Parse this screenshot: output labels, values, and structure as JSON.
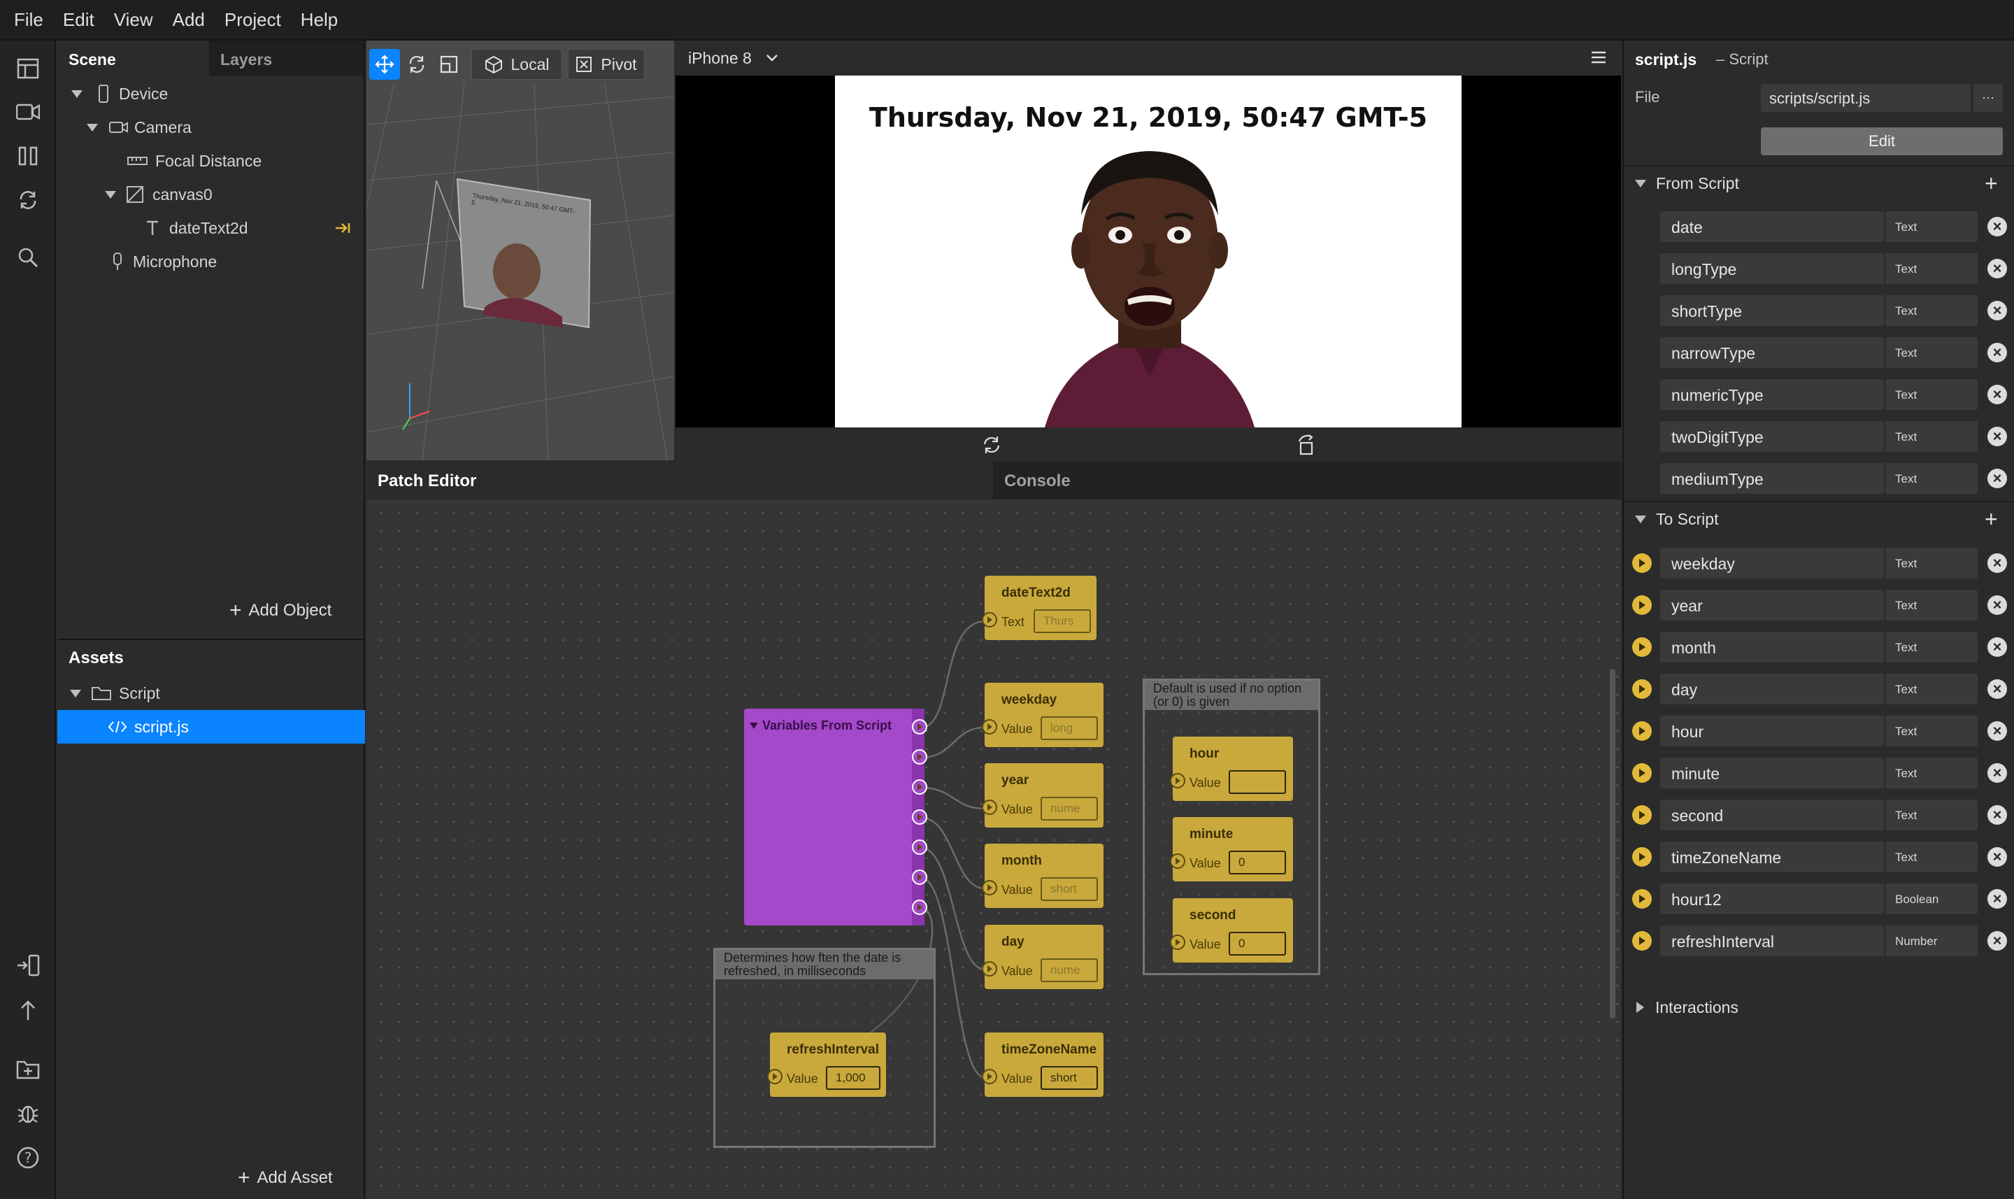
{
  "menu": [
    "File",
    "Edit",
    "View",
    "Add",
    "Project",
    "Help"
  ],
  "scene": {
    "tab_scene": "Scene",
    "tab_layers": "Layers",
    "tree": {
      "device": "Device",
      "camera": "Camera",
      "focal": "Focal Distance",
      "canvas": "canvas0",
      "text": "dateText2d",
      "mic": "Microphone"
    },
    "add_object": "Add Object"
  },
  "assets": {
    "title": "Assets",
    "folder": "Script",
    "file": "script.js",
    "add_asset": "Add Asset"
  },
  "viewport": {
    "local": "Local",
    "pivot": "Pivot",
    "preview_text": "Thursday, Nov 21, 2019, 50:47 GMT-5"
  },
  "simulator": {
    "device": "iPhone 8",
    "caption": "Thursday, Nov 21, 2019, 50:47 GMT-5"
  },
  "patch_editor": {
    "tab_patch": "Patch Editor",
    "tab_console": "Console",
    "vars_node": "Variables From Script",
    "comment_defaults": "Default is used if no option (or 0) is given",
    "comment_refresh": "Determines how ften the date is refreshed, in milliseconds",
    "nodes": {
      "datetext": {
        "title": "dateText2d",
        "label": "Text",
        "value": "Thurs"
      },
      "weekday": {
        "title": "weekday",
        "label": "Value",
        "value": "long"
      },
      "year": {
        "title": "year",
        "label": "Value",
        "value": "nume"
      },
      "month": {
        "title": "month",
        "label": "Value",
        "value": "short"
      },
      "day": {
        "title": "day",
        "label": "Value",
        "value": "nume"
      },
      "hour": {
        "title": "hour",
        "label": "Value",
        "value": ""
      },
      "minute": {
        "title": "minute",
        "label": "Value",
        "value": "0"
      },
      "second": {
        "title": "second",
        "label": "Value",
        "value": "0"
      },
      "refresh": {
        "title": "refreshInterval",
        "label": "Value",
        "value": "1,000"
      },
      "tz": {
        "title": "timeZoneName",
        "label": "Value",
        "value": "short"
      }
    }
  },
  "inspector": {
    "filename": "script.js",
    "kind": "– Script",
    "file_label": "File",
    "file_path": "scripts/script.js",
    "more": "···",
    "edit": "Edit",
    "from_script": "From Script",
    "to_script": "To Script",
    "interactions": "Interactions",
    "from_vars": [
      {
        "name": "date",
        "type": "Text"
      },
      {
        "name": "longType",
        "type": "Text"
      },
      {
        "name": "shortType",
        "type": "Text"
      },
      {
        "name": "narrowType",
        "type": "Text"
      },
      {
        "name": "numericType",
        "type": "Text"
      },
      {
        "name": "twoDigitType",
        "type": "Text"
      },
      {
        "name": "mediumType",
        "type": "Text"
      }
    ],
    "to_vars": [
      {
        "name": "weekday",
        "type": "Text"
      },
      {
        "name": "year",
        "type": "Text"
      },
      {
        "name": "month",
        "type": "Text"
      },
      {
        "name": "day",
        "type": "Text"
      },
      {
        "name": "hour",
        "type": "Text"
      },
      {
        "name": "minute",
        "type": "Text"
      },
      {
        "name": "second",
        "type": "Text"
      },
      {
        "name": "timeZoneName",
        "type": "Text"
      },
      {
        "name": "hour12",
        "type": "Boolean"
      },
      {
        "name": "refreshInterval",
        "type": "Number"
      }
    ]
  },
  "colors": {
    "accent": "#0a84ff",
    "patch_node": "#c9a93c",
    "script_node": "#a349c9",
    "warning_arrow": "#e2b93b"
  }
}
